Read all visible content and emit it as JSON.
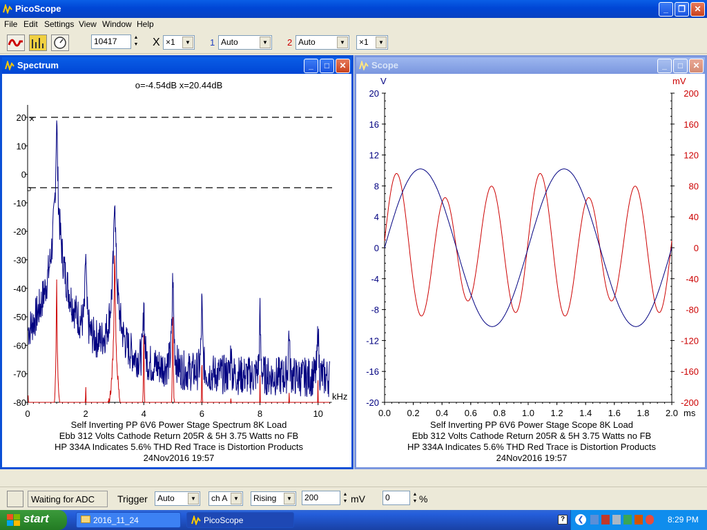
{
  "app": {
    "title": "PicoScope"
  },
  "menu": [
    "File",
    "Edit",
    "Settings",
    "View",
    "Window",
    "Help"
  ],
  "toolbar": {
    "samples": "10417",
    "x_label": "X",
    "x_mult": "×1",
    "ch1_num": "1",
    "ch1_range": "Auto",
    "ch2_num": "2",
    "ch2_range": "Auto",
    "y_mult": "×1"
  },
  "spectrum": {
    "title": "Spectrum",
    "readout": "o=-4.54dB  x=20.44dB",
    "marker_o": "o",
    "marker_x": "×",
    "caption": [
      "Self Inverting PP 6V6 Power Stage Spectrum 8K Load",
      "Ebb 312 Volts Cathode Return 205R & 5H 3.75 Watts no FB",
      "HP 334A Indicates 5.6% THD Red Trace is Distortion Products",
      "24Nov2016  19:57"
    ]
  },
  "scope": {
    "title": "Scope",
    "caption": [
      "Self Inverting PP 6V6 Power Stage Scope 8K Load",
      "Ebb 312 Volts Cathode Return 205R & 5H 3.75 Watts no FB",
      "HP 334A Indicates 5.6% THD Red Trace is Distortion Products",
      "24Nov2016  19:57"
    ]
  },
  "chart_data": [
    {
      "type": "line",
      "title": "Spectrum",
      "xlabel": "kHz",
      "ylabel": "",
      "xlim": [
        0,
        10.4
      ],
      "ylim": [
        -80,
        20
      ],
      "x_ticks": [
        0,
        2,
        4,
        6,
        8,
        10
      ],
      "y_ticks": [
        20,
        10,
        0,
        -10,
        -20,
        -30,
        -40,
        -50,
        -60,
        -70,
        -80
      ],
      "markers": {
        "o_dB": -4.54,
        "x_dB": 20.44
      },
      "series": [
        {
          "color": "#000080",
          "peaks": [
            [
              1.0,
              20.4
            ],
            [
              2.0,
              -27.5
            ],
            [
              3.0,
              -4.5
            ],
            [
              4.0,
              -43
            ],
            [
              5.0,
              -35
            ],
            [
              6.0,
              -45
            ],
            [
              7.0,
              -61
            ],
            [
              8.0,
              -50
            ],
            [
              9.0,
              -54
            ],
            [
              10.0,
              -52
            ]
          ]
        },
        {
          "color": "#cc0000",
          "peaks": [
            [
              1.0,
              -37
            ],
            [
              2.0,
              -74
            ],
            [
              3.0,
              -23
            ],
            [
              4.0,
              -55
            ],
            [
              5.0,
              -47
            ],
            [
              6.0,
              -63
            ],
            [
              7.0,
              -79
            ],
            [
              8.0,
              -73
            ],
            [
              9.0,
              -75
            ],
            [
              10.0,
              -73
            ]
          ]
        }
      ]
    },
    {
      "type": "line",
      "title": "Scope",
      "xlabel": "ms",
      "x_ticks": [
        "0.0",
        "0.2",
        "0.4",
        "0.6",
        "0.8",
        "1.0",
        "1.2",
        "1.4",
        "1.6",
        "1.8",
        "2.0"
      ],
      "xlim": [
        0,
        2.0
      ],
      "left_axis": {
        "unit": "V",
        "ylim": [
          -20,
          20
        ],
        "ticks": [
          20,
          16,
          12,
          8,
          4,
          0,
          -4,
          -8,
          -12,
          -16,
          -20
        ]
      },
      "right_axis": {
        "unit": "mV",
        "ylim": [
          -200,
          200
        ],
        "ticks": [
          200,
          160,
          120,
          80,
          40,
          0,
          -40,
          -80,
          -120,
          -160,
          -200
        ]
      },
      "series": [
        {
          "color": "#000080",
          "axis": "left",
          "waveform": "sine",
          "amplitude_V": 10.2,
          "frequency_kHz": 1.0
        },
        {
          "color": "#cc0000",
          "axis": "right",
          "waveform": "harmonic distortion",
          "fundamental_kHz": 1.0,
          "amplitude_mV": [
            83,
            97,
            57
          ]
        }
      ]
    }
  ],
  "status": {
    "text": "Waiting for ADC",
    "trigger_label": "Trigger",
    "trigger_mode": "Auto",
    "channel": "ch A",
    "edge": "Rising",
    "level": "200",
    "level_unit": "mV",
    "delay": "0",
    "delay_unit": "%"
  },
  "taskbar": {
    "start": "start",
    "items": [
      "2016_11_24",
      "PicoScope"
    ],
    "clock": "8:29 PM"
  },
  "colors": {
    "titlebar": "#0046d5",
    "trace_blue": "#000080",
    "trace_red": "#cc0000",
    "taskbar": "#245edb"
  }
}
